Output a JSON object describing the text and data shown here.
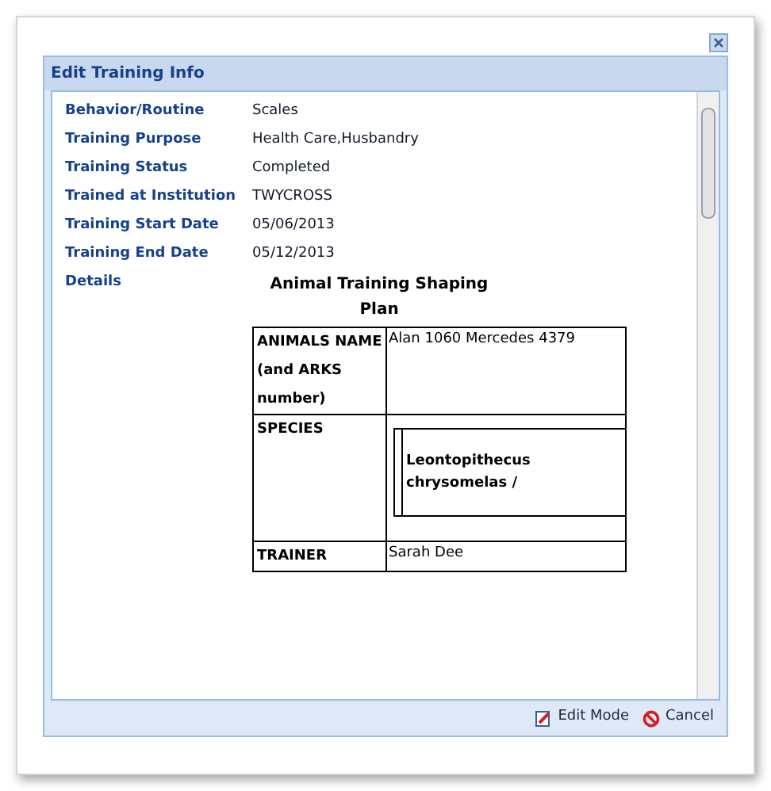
{
  "dialog": {
    "title": "Edit Training Info",
    "fields": [
      {
        "label": "Behavior/Routine",
        "value": "Scales"
      },
      {
        "label": "Training Purpose",
        "value": "Health Care,Husbandry"
      },
      {
        "label": "Training Status",
        "value": "Completed"
      },
      {
        "label": "Trained at Institution",
        "value": "TWYCROSS"
      },
      {
        "label": "Training Start Date",
        "value": "05/06/2013"
      },
      {
        "label": "Training End Date",
        "value": "05/12/2013"
      }
    ],
    "details": {
      "label": "Details",
      "heading": "Animal Training Shaping Plan",
      "rows": [
        {
          "header": "ANIMALS NAME (and ARKS number)",
          "value": "Alan 1060 Mercedes 4379",
          "kind": "plain"
        },
        {
          "header": "SPECIES",
          "value": "Leontopithecus chrysomelas /",
          "kind": "nested"
        },
        {
          "header": "TRAINER",
          "value": "Sarah Dee",
          "kind": "plain"
        }
      ]
    },
    "buttons": [
      {
        "kind": "edit",
        "label": "Edit Mode"
      },
      {
        "kind": "cancel",
        "label": "Cancel"
      }
    ]
  }
}
